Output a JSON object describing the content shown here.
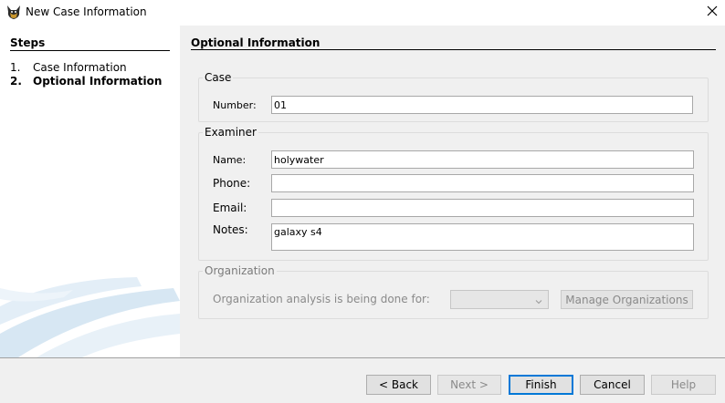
{
  "window": {
    "title": "New Case Information"
  },
  "steps": {
    "header": "Steps",
    "items": [
      {
        "num": "1.",
        "label": "Case Information"
      },
      {
        "num": "2.",
        "label": "Optional Information"
      }
    ]
  },
  "main": {
    "title": "Optional Information",
    "case": {
      "legend": "Case",
      "number_label": "Number:",
      "number_value": "01"
    },
    "examiner": {
      "legend": "Examiner",
      "name_label": "Name:",
      "name_value": "holywater",
      "phone_label": "Phone:",
      "phone_value": "",
      "email_label": "Email:",
      "email_value": "",
      "notes_label": "Notes:",
      "notes_value": "galaxy s4"
    },
    "organization": {
      "legend": "Organization",
      "prompt_label": "Organization analysis is being done for:",
      "selected_value": "",
      "manage_label": "Manage Organizations"
    }
  },
  "footer": {
    "back_label": "< Back",
    "next_label": "Next >",
    "finish_label": "Finish",
    "cancel_label": "Cancel",
    "help_label": "Help"
  },
  "colors": {
    "panel_bg": "#f0f0f0",
    "accent_default_button": "#0078d7",
    "swoosh": "#d7e7f3"
  },
  "icons": {
    "app": "dog-head-icon",
    "close": "close-icon",
    "combo": "chevron-down-icon"
  }
}
